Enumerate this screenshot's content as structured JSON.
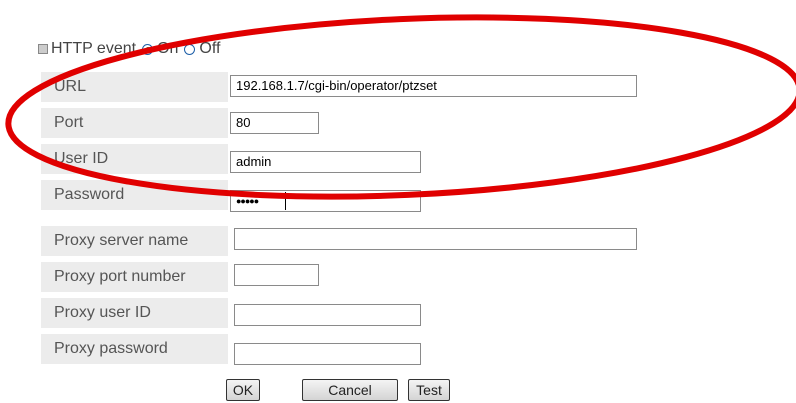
{
  "http_event": {
    "label": "HTTP event",
    "on_label": "On",
    "off_label": "Off",
    "selected": "On"
  },
  "fields": {
    "url": {
      "label": "URL",
      "value": "192.168.1.7/cgi-bin/operator/ptzset"
    },
    "port": {
      "label": "Port",
      "value": "80"
    },
    "user_id": {
      "label": "User ID",
      "value": "admin"
    },
    "password": {
      "label": "Password",
      "value": "●●●●●"
    },
    "proxy_server_name": {
      "label": "Proxy server name",
      "value": ""
    },
    "proxy_port_number": {
      "label": "Proxy port number",
      "value": ""
    },
    "proxy_user_id": {
      "label": "Proxy user ID",
      "value": ""
    },
    "proxy_password": {
      "label": "Proxy password",
      "value": ""
    }
  },
  "buttons": {
    "ok": "OK",
    "cancel": "Cancel",
    "test": "Test"
  },
  "colors": {
    "annotation": "#e00000",
    "label_bg": "#ececec"
  }
}
